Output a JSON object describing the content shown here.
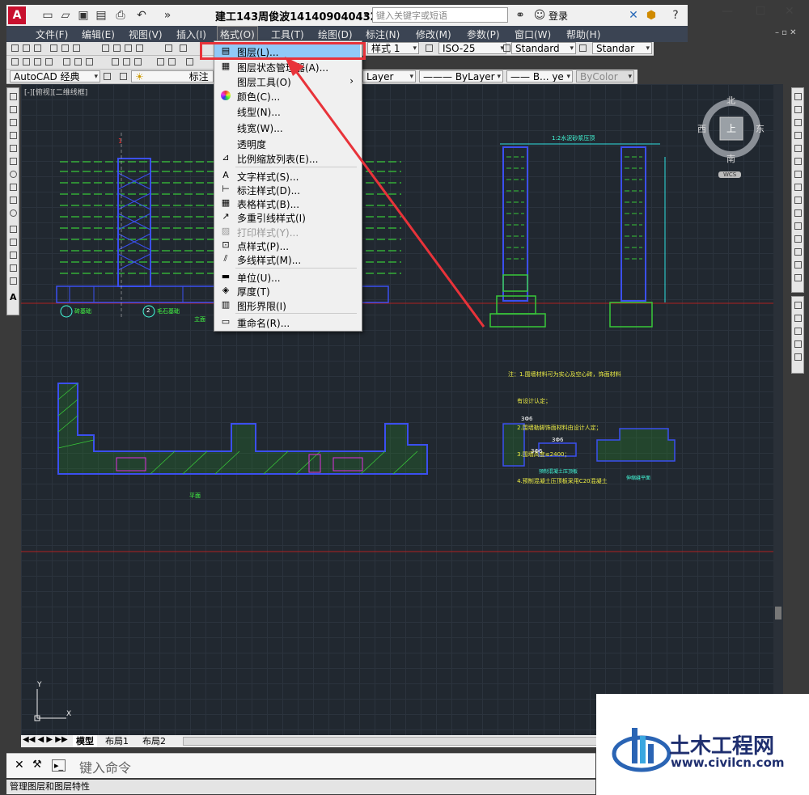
{
  "window": {
    "title": "建工143周俊波141409040432....",
    "search_placeholder": "键入关键字或短语",
    "login": "登录"
  },
  "menubar": {
    "items": [
      "文件(F)",
      "编辑(E)",
      "视图(V)",
      "插入(I)",
      "格式(O)",
      "工具(T)",
      "绘图(D)",
      "标注(N)",
      "修改(M)",
      "参数(P)",
      "窗口(W)",
      "帮助(H)"
    ],
    "active": "格式(O)"
  },
  "toolbar": {
    "style_combo_suffix": "样式 1",
    "dim_style": "ISO-25",
    "table_style": "Standard",
    "mleader_style": "Standar",
    "workspace": "AutoCAD 经典",
    "layer_combo_suffix": "标注",
    "layer_right": "Layer",
    "linetype": "ByLayer",
    "lineweight": "B... ye",
    "plotstyle": "ByColor"
  },
  "format_menu": {
    "items": [
      {
        "label": "图层(L)...",
        "icon": "layers-icon",
        "highlight": true
      },
      {
        "label": "图层状态管理器(A)...",
        "icon": "layer-state-icon"
      },
      {
        "label": "图层工具(O)",
        "icon": "",
        "submenu": true
      },
      {
        "label": "颜色(C)...",
        "icon": "color-wheel-icon"
      },
      {
        "label": "线型(N)...",
        "icon": ""
      },
      {
        "label": "线宽(W)...",
        "icon": ""
      },
      {
        "label": "透明度",
        "icon": ""
      },
      {
        "label": "比例缩放列表(E)...",
        "icon": "scale-list-icon"
      },
      {
        "label": "文字样式(S)...",
        "icon": "text-style-icon"
      },
      {
        "label": "标注样式(D)...",
        "icon": "dim-style-icon"
      },
      {
        "label": "表格样式(B)...",
        "icon": "table-style-icon"
      },
      {
        "label": "多重引线样式(I)",
        "icon": "mleader-style-icon"
      },
      {
        "label": "打印样式(Y)...",
        "icon": "plot-style-icon",
        "disabled": true
      },
      {
        "label": "点样式(P)...",
        "icon": "point-style-icon"
      },
      {
        "label": "多线样式(M)...",
        "icon": "mline-style-icon"
      },
      {
        "label": "单位(U)...",
        "icon": "units-icon"
      },
      {
        "label": "厚度(T)",
        "icon": "thickness-icon"
      },
      {
        "label": "图形界限(I)",
        "icon": "limits-icon"
      },
      {
        "label": "重命名(R)...",
        "icon": "rename-icon"
      }
    ]
  },
  "drawing": {
    "view_label": "[-][俯视][二维线框]",
    "viewcube": {
      "north": "北",
      "south": "南",
      "east": "东",
      "west": "西",
      "top": "上",
      "wcs": "WCS"
    },
    "annotations": {
      "label1": "砖基础",
      "label2": "毛石基础",
      "elevation": "立面",
      "plan": "平面",
      "top_note": "1:2水泥砂浆压顶",
      "notes": [
        "注：1.围墙材料可为实心及空心砖，饰面材料",
        "     有设计认定；",
        "     2.围墙勒脚饰面材料由设计人定；",
        "     3.围墙高度≤2400；",
        "     4.预制混凝土压顶板采用C20混凝土"
      ],
      "rebar1": "3Φ6",
      "rebar2": "3Φ6",
      "rebar3": "3Φ6",
      "precast": "预制混凝土压顶板",
      "joint": "伸缩缝平面",
      "num1": "1",
      "num2": "2"
    },
    "axis_y": "Y",
    "axis_x": "X"
  },
  "tabs": [
    "模型",
    "布局1",
    "布局2"
  ],
  "command_placeholder": "键入命令",
  "status_text": "管理图层和图层特性",
  "brand": {
    "name": "土木工程网",
    "url": "www.civilcn.com"
  }
}
